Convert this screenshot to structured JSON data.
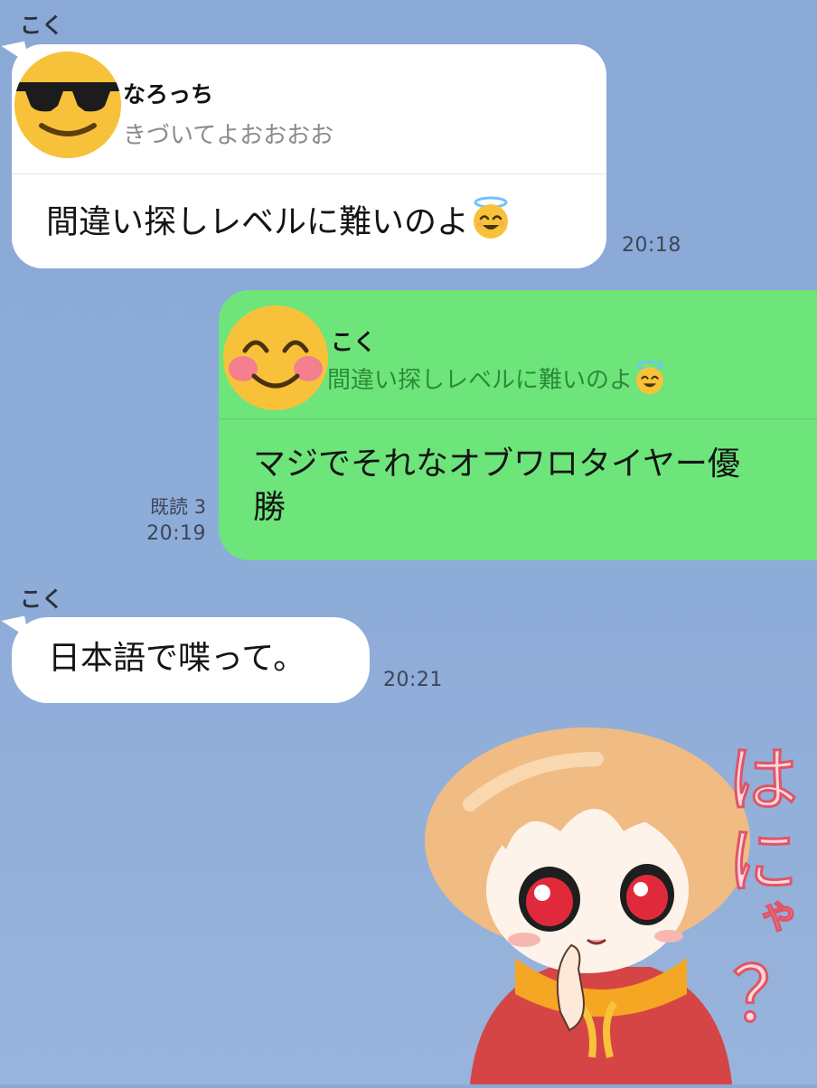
{
  "colors": {
    "background": "#8eacd8",
    "incoming_bubble": "#ffffff",
    "outgoing_bubble": "#6de57b",
    "avatar_yellow": "#f7c23a"
  },
  "messages": [
    {
      "sender": "こく",
      "reply_to": {
        "name": "なろっち",
        "text": "きづいてよおおおお",
        "avatar_icon": "sunglasses-emoji-icon"
      },
      "text": "間違い探しレベルに難いのよ",
      "emoji": "smiling-halo-emoji-icon",
      "time": "20:18"
    },
    {
      "reply_to": {
        "name": "こく",
        "text": "間違い探しレベルに難いのよ",
        "avatar_icon": "blushing-smile-emoji-icon"
      },
      "text_line1": "マジでそれなオブワロタイヤー優",
      "text_line2": "勝",
      "read": "既読 3",
      "time": "20:19"
    },
    {
      "sender": "こく",
      "text": "日本語で喋って。",
      "time": "20:21"
    },
    {
      "sticker": {
        "text_chars": [
          "は",
          "に",
          "ゃ",
          "？"
        ],
        "icon": "anime-girl-sticker-icon"
      }
    }
  ]
}
